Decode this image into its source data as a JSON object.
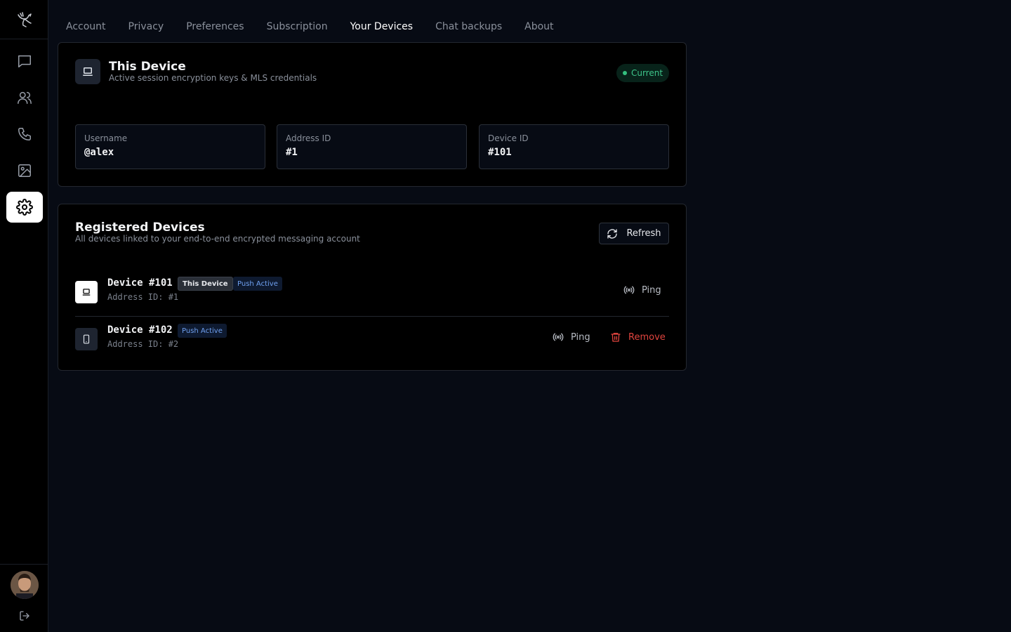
{
  "sidebar": {
    "nav": [
      "chat-icon",
      "contacts-icon",
      "phone-icon",
      "gallery-icon",
      "settings-icon"
    ],
    "active": "settings-icon"
  },
  "tabs": [
    "Account",
    "Privacy",
    "Preferences",
    "Subscription",
    "Your Devices",
    "Chat backups",
    "About"
  ],
  "active_tab": "Your Devices",
  "this_device": {
    "title": "This Device",
    "subtitle": "Active session encryption keys & MLS credentials",
    "badge": "Current",
    "fields": [
      {
        "label": "Username",
        "value": "@alex"
      },
      {
        "label": "Address ID",
        "value": "#1"
      },
      {
        "label": "Device ID",
        "value": "#101"
      }
    ]
  },
  "registered": {
    "title": "Registered Devices",
    "subtitle": "All devices linked to your end-to-end encrypted messaging account",
    "refresh_label": "Refresh",
    "devices": [
      {
        "name": "Device #101",
        "address": "Address ID: #1",
        "this_chip": "This Device",
        "push_chip": "Push Active",
        "ping": "Ping"
      },
      {
        "name": "Device #102",
        "address": "Address ID: #2",
        "push_chip": "Push Active",
        "ping": "Ping",
        "remove": "Remove"
      }
    ]
  },
  "colors": {
    "accent_green": "#3ec58a",
    "push_blue": "#6fa0f0",
    "danger": "#e0443e",
    "background": "#070b14"
  }
}
